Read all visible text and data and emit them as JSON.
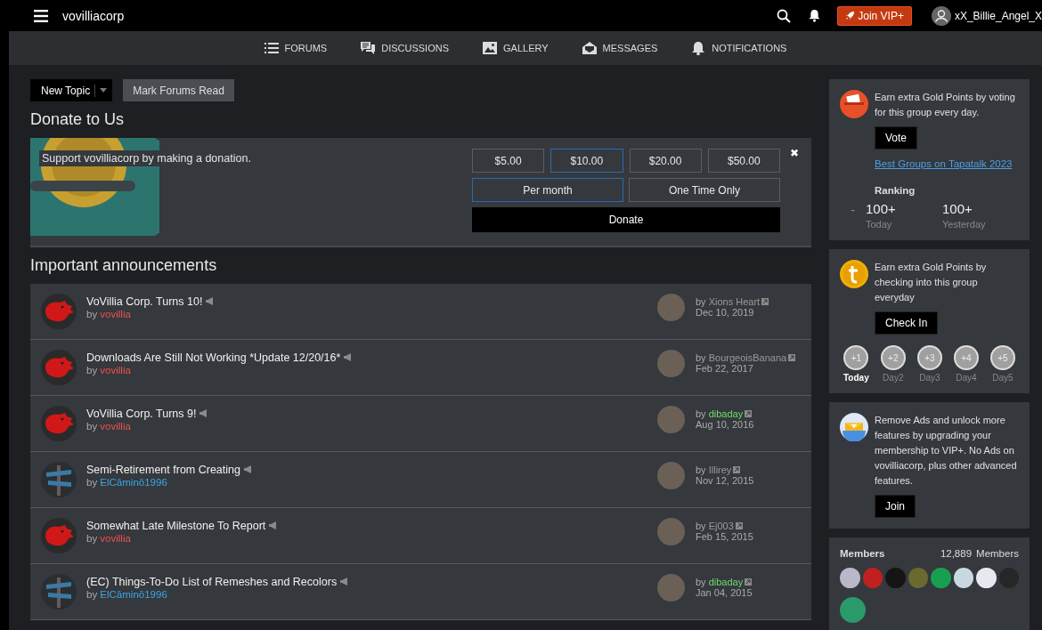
{
  "topbar": {
    "site_name": "vovilliacorp",
    "vip_button": "Join VIP+",
    "username": "xX_Billie_Angel_X"
  },
  "nav": [
    {
      "label": "FORUMS"
    },
    {
      "label": "DISCUSSIONS"
    },
    {
      "label": "GALLERY"
    },
    {
      "label": "MESSAGES"
    },
    {
      "label": "NOTIFICATIONS"
    }
  ],
  "actions": {
    "new_topic": "New Topic",
    "mark_read": "Mark Forums Read"
  },
  "donate": {
    "heading": "Donate to Us",
    "message": "Support vovilliacorp by making a donation.",
    "amounts": [
      {
        "label": "$5.00",
        "selected": false
      },
      {
        "label": "$10.00",
        "selected": true
      },
      {
        "label": "$20.00",
        "selected": false
      },
      {
        "label": "$50.00",
        "selected": false
      }
    ],
    "frequency": [
      {
        "label": "Per month",
        "selected": true
      },
      {
        "label": "One Time Only",
        "selected": false
      }
    ],
    "button": "Donate",
    "close": "✖"
  },
  "announcements": {
    "heading": "Important announcements",
    "rows": [
      {
        "kind": "dragon",
        "title": "VoVillia Corp. Turns 10!",
        "author": {
          "prefix": "by",
          "name": "vovillia",
          "color": "#f05050"
        },
        "last_post": {
          "prefix": "by",
          "name": "Xions Heart",
          "color": "#9a9a9a"
        },
        "date": "Dec 10, 2019"
      },
      {
        "kind": "dragon",
        "title": "Downloads Are Still Not Working *Update 12/20/16*",
        "author": {
          "prefix": "by",
          "name": "vovillia",
          "color": "#f05050"
        },
        "last_post": {
          "prefix": "by",
          "name": "BourgeoisBanana",
          "color": "#9a9a9a"
        },
        "date": "Feb 22, 2017"
      },
      {
        "kind": "dragon",
        "title": "VoVillia Corp. Turns 9!",
        "author": {
          "prefix": "by",
          "name": "vovillia",
          "color": "#f05050"
        },
        "last_post": {
          "prefix": "by",
          "name": "dibaday",
          "color": "#6fdc6f"
        },
        "date": "Aug 10, 2016"
      },
      {
        "kind": "sign",
        "title": "Semi-Retirement from Creating",
        "author": {
          "prefix": "by",
          "name": "ElCāminō1996",
          "color": "#3aa8e8"
        },
        "last_post": {
          "prefix": "by",
          "name": "Illirey",
          "color": "#9a9a9a"
        },
        "date": "Nov 12, 2015"
      },
      {
        "kind": "dragon",
        "title": "Somewhat Late Milestone To Report",
        "author": {
          "prefix": "by",
          "name": "vovillia",
          "color": "#f05050"
        },
        "last_post": {
          "prefix": "by",
          "name": "Ej003",
          "color": "#9a9a9a"
        },
        "date": "Feb 15, 2015"
      },
      {
        "kind": "sign",
        "title": "(EC) Things-To-Do List of Remeshes and Recolors",
        "author": {
          "prefix": "by",
          "name": "ElCāminō1996",
          "color": "#3aa8e8"
        },
        "last_post": {
          "prefix": "by",
          "name": "dibaday",
          "color": "#6fdc6f"
        },
        "date": "Jan 04, 2015"
      }
    ]
  },
  "vote_card": {
    "text": "Earn extra Gold Points by voting for this group every day.",
    "button": "Vote",
    "link": "Best Groups on Tapatalk 2023",
    "ranking_label": "Ranking",
    "trend": "-",
    "stats": [
      {
        "value": "100+",
        "label": "Today"
      },
      {
        "value": "100+",
        "label": "Yesterday"
      }
    ]
  },
  "checkin_card": {
    "text": "Earn extra Gold Points by checking into this group everyday",
    "button": "Check In",
    "days": [
      {
        "points": "+1",
        "label": "Today",
        "selected": true
      },
      {
        "points": "+2",
        "label": "Day2",
        "selected": false
      },
      {
        "points": "+3",
        "label": "Day3",
        "selected": false
      },
      {
        "points": "+4",
        "label": "Day4",
        "selected": false
      },
      {
        "points": "+5",
        "label": "Day5",
        "selected": false
      }
    ]
  },
  "vip_card": {
    "text": "Remove Ads and unlock more features by upgrading your membership to VIP+. No Ads on vovilliacorp, plus other advanced features.",
    "button": "Join"
  },
  "members": {
    "title": "Members",
    "count": "12,889",
    "count_label": "Members"
  }
}
